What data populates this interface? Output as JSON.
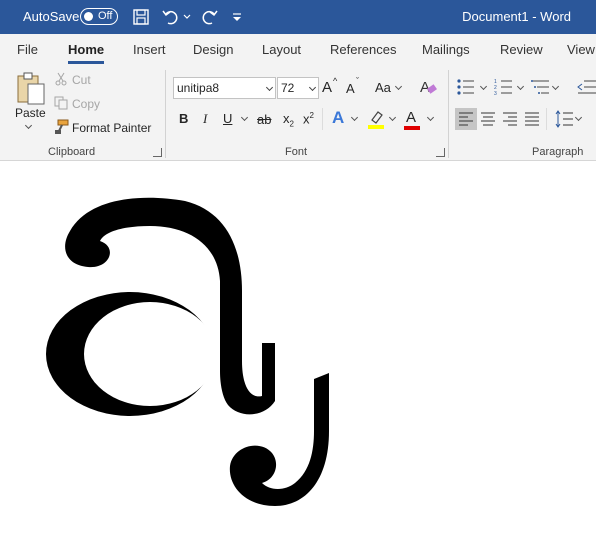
{
  "titlebar": {
    "autosave_label": "AutoSave",
    "autosave_state": "Off",
    "document_title": "Document1  -  Word",
    "bg_color": "#2b579a"
  },
  "tabs": [
    "File",
    "Home",
    "Insert",
    "Design",
    "Layout",
    "References",
    "Mailings",
    "Review",
    "View"
  ],
  "active_tab": "Home",
  "clipboard": {
    "paste": "Paste",
    "cut": "Cut",
    "copy": "Copy",
    "format_painter": "Format Painter",
    "group_label": "Clipboard"
  },
  "font": {
    "font_name": "unitipa8",
    "font_size": "72",
    "grow": "A",
    "shrink": "A",
    "change_case": "Aa",
    "bold": "B",
    "italic": "I",
    "underline": "U",
    "strikethrough": "ab",
    "subscript": "x",
    "subscript_mark": "2",
    "superscript": "x",
    "superscript_mark": "2",
    "text_effects": "A",
    "font_color": "A",
    "group_label": "Font"
  },
  "paragraph": {
    "group_label": "Paragraph"
  },
  "document": {
    "glyph_description_icon": "a-with-retroflex-hook-glyph"
  }
}
